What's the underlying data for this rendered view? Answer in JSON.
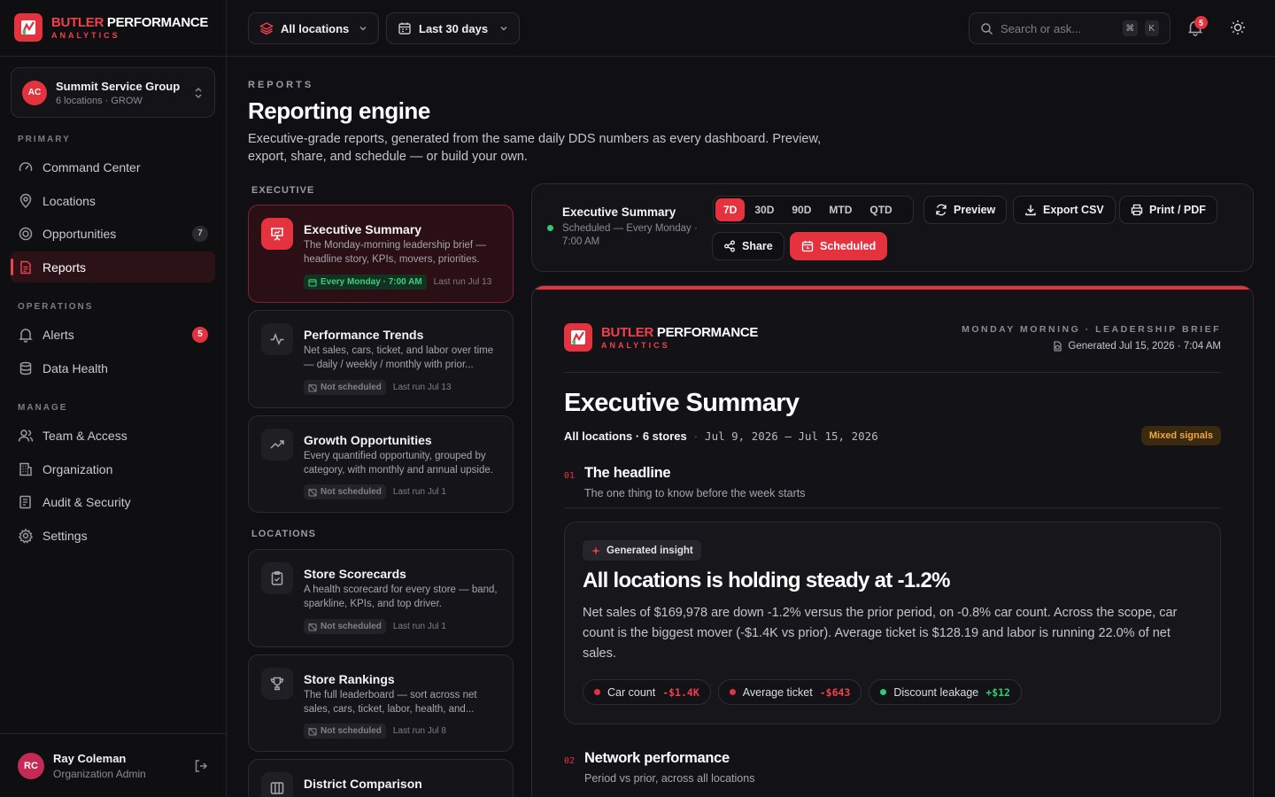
{
  "brand": {
    "name_a": "BUTLER",
    "name_b": " PERFORMANCE",
    "tagline": "ANALYTICS"
  },
  "colors": {
    "accent": "#e5323f",
    "success": "#2ecc71",
    "warning": "#f0a73a",
    "background": "#101014"
  },
  "org": {
    "initials": "AC",
    "name": "Summit Service Group",
    "sub": "6 locations · GROW"
  },
  "nav": {
    "sections": {
      "primary": "PRIMARY",
      "operations": "OPERATIONS",
      "manage": "MANAGE"
    },
    "items": [
      {
        "label": "Command Center",
        "icon": "gauge-icon"
      },
      {
        "label": "Locations",
        "icon": "map-pin-icon"
      },
      {
        "label": "Opportunities",
        "icon": "target-icon",
        "badge": "7"
      },
      {
        "label": "Reports",
        "icon": "file-text-icon",
        "active": true
      },
      {
        "label": "Alerts",
        "icon": "bell-icon",
        "badge": "5"
      },
      {
        "label": "Data Health",
        "icon": "database-icon"
      },
      {
        "label": "Team & Access",
        "icon": "users-icon"
      },
      {
        "label": "Organization",
        "icon": "building-icon"
      },
      {
        "label": "Audit & Security",
        "icon": "audit-icon"
      },
      {
        "label": "Settings",
        "icon": "gear-icon"
      }
    ]
  },
  "user": {
    "initials": "RC",
    "name": "Ray Coleman",
    "role": "Organization Admin"
  },
  "topbar": {
    "location_filter": "All locations",
    "date_filter": "Last 30 days",
    "search_placeholder": "Search or ask...",
    "kbd_cmd": "⌘",
    "kbd_k": "K",
    "notifications": "5"
  },
  "page": {
    "eyebrow": "REPORTS",
    "title": "Reporting engine",
    "description": "Executive-grade reports, generated from the same daily DDS numbers as every dashboard. Preview, export, share, and schedule — or build your own."
  },
  "report_list": {
    "section_executive": "EXECUTIVE",
    "section_locations": "LOCATIONS",
    "reports": [
      {
        "title": "Executive Summary",
        "desc": "The Monday-morning leadership brief — headline story, KPIs, movers, priorities.",
        "schedule": "Every Monday · 7:00 AM",
        "last_run": "Last run Jul 13",
        "icon": "presentation-icon"
      },
      {
        "title": "Performance Trends",
        "desc": "Net sales, cars, ticket, and labor over time — daily / weekly / monthly with prior...",
        "schedule": "Not scheduled",
        "last_run": "Last run Jul 13",
        "icon": "activity-icon"
      },
      {
        "title": "Growth Opportunities",
        "desc": "Every quantified opportunity, grouped by category, with monthly and annual upside.",
        "schedule": "Not scheduled",
        "last_run": "Last run Jul 1",
        "icon": "trending-up-icon"
      },
      {
        "title": "Store Scorecards",
        "desc": "A health scorecard for every store — band, sparkline, KPIs, and top driver.",
        "schedule": "Not scheduled",
        "last_run": "Last run Jul 1",
        "icon": "clipboard-icon"
      },
      {
        "title": "Store Rankings",
        "desc": "The full leaderboard — sort across net sales, cars, ticket, labor, health, and...",
        "schedule": "Not scheduled",
        "last_run": "Last run Jul 8",
        "icon": "trophy-icon"
      },
      {
        "title": "District Comparison",
        "desc": "",
        "schedule": "",
        "last_run": "",
        "icon": "columns-icon"
      }
    ]
  },
  "actionbar": {
    "title": "Executive Summary",
    "sub": "Scheduled — Every Monday · 7:00 AM",
    "periods": [
      "7D",
      "30D",
      "90D",
      "MTD",
      "QTD"
    ],
    "active_period": "7D",
    "preview": "Preview",
    "export_csv": "Export CSV",
    "print_pdf": "Print / PDF",
    "share": "Share",
    "scheduled": "Scheduled"
  },
  "preview": {
    "meta_top": "MONDAY MORNING · LEADERSHIP BRIEF",
    "generated": "Generated Jul 15, 2026 · 7:04 AM",
    "title": "Executive Summary",
    "scope": "All locations · 6 stores",
    "sep": "·",
    "date_range": "Jul 9, 2026 – Jul 15, 2026",
    "signal": "Mixed signals",
    "sec1_num": "01",
    "sec1_title": "The headline",
    "sec1_sub": "The one thing to know before the week starts",
    "insight_chip": "Generated insight",
    "insight_heading": "All locations is holding steady at -1.2%",
    "insight_body": "Net sales of $169,978 are down -1.2% versus the prior period, on -0.8% car count. Across the scope, car count is the biggest mover (-$1.4K vs prior). Average ticket is $128.19 and labor is running 22.0% of net sales.",
    "movers": [
      {
        "label": "Car count",
        "value": "-$1.4K",
        "tone": "negative"
      },
      {
        "label": "Average ticket",
        "value": "-$643",
        "tone": "negative"
      },
      {
        "label": "Discount leakage",
        "value": "+$12",
        "tone": "positive"
      }
    ],
    "sec2_num": "02",
    "sec2_title": "Network performance",
    "sec2_sub": "Period vs prior, across all locations"
  }
}
